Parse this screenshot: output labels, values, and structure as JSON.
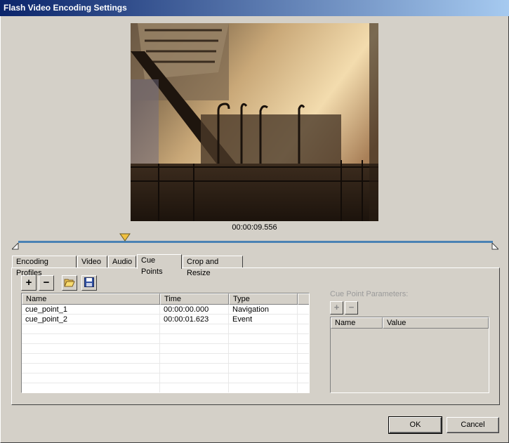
{
  "window": {
    "title": "Flash Video Encoding Settings"
  },
  "preview": {
    "timecode": "00:00:09.556"
  },
  "scrubber": {
    "position": 0.225
  },
  "tabs": [
    {
      "label": "Encoding Profiles"
    },
    {
      "label": "Video"
    },
    {
      "label": "Audio"
    },
    {
      "label": "Cue Points"
    },
    {
      "label": "Crop and Resize"
    }
  ],
  "active_tab": "Cue Points",
  "toolbar": {
    "add_label": "+",
    "remove_label": "−",
    "open_icon": "folder-open-icon",
    "save_icon": "floppy-disk-icon"
  },
  "cue_table": {
    "columns": [
      "Name",
      "Time",
      "Type"
    ],
    "rows": [
      {
        "name": "cue_point_1",
        "time": "00:00:00.000",
        "type": "Navigation"
      },
      {
        "name": "cue_point_2",
        "time": "00:00:01.623",
        "type": "Event"
      }
    ]
  },
  "cue_params": {
    "label": "Cue Point Parameters:",
    "add_label": "+",
    "remove_label": "−",
    "columns": [
      "Name",
      "Value"
    ]
  },
  "buttons": {
    "ok": "OK",
    "cancel": "Cancel"
  },
  "colors": {
    "titlebar": "#0a246a",
    "scrub_track": "#4a82b4",
    "marker": "#f0c040"
  }
}
